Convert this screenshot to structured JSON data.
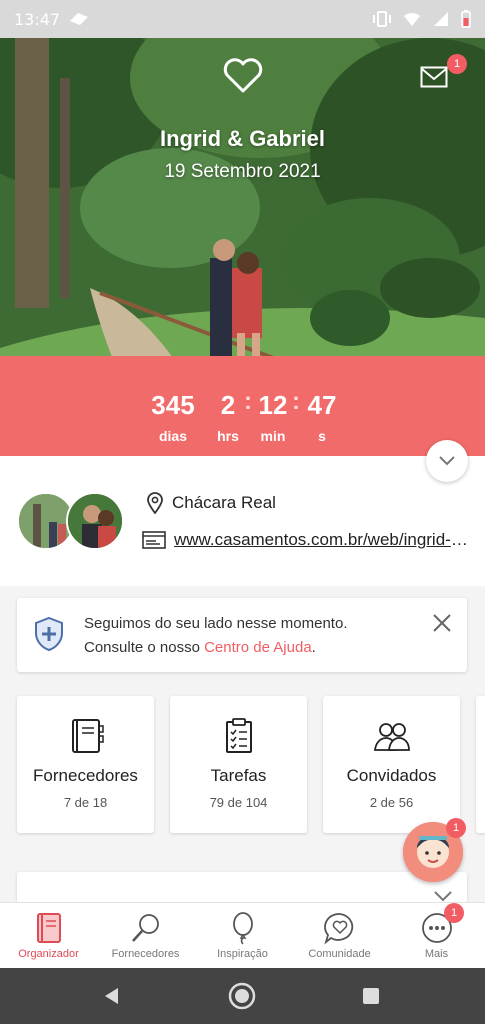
{
  "status_bar": {
    "time": "13:47"
  },
  "hero": {
    "names": "Ingrid & Gabriel",
    "date": "19 Setembro 2021",
    "mail_badge": "1"
  },
  "countdown": {
    "days": "345",
    "days_label": "dias",
    "hours": "2",
    "hours_label": "hrs",
    "minutes": "12",
    "minutes_label": "min",
    "seconds": "47",
    "seconds_label": "s"
  },
  "info": {
    "location": "Chácara Real",
    "website": "www.casamentos.com.br/web/ingrid-e-gabriel"
  },
  "help_card": {
    "line1": "Seguimos do seu lado nesse momento.",
    "line2_prefix": "Consulte o nosso ",
    "line2_link": "Centro de Ajuda",
    "line2_suffix": "."
  },
  "tiles": [
    {
      "title": "Fornecedores",
      "subtitle": "7 de 18"
    },
    {
      "title": "Tarefas",
      "subtitle": "79 de 104"
    },
    {
      "title": "Convidados",
      "subtitle": "2 de 56"
    }
  ],
  "float_badge": "1",
  "nav": {
    "items": [
      {
        "label": "Organizador"
      },
      {
        "label": "Fornecedores"
      },
      {
        "label": "Inspiração"
      },
      {
        "label": "Comunidade"
      },
      {
        "label": "Mais"
      }
    ],
    "more_badge": "1"
  },
  "colors": {
    "accent": "#f15d63",
    "countdown_bg": "#f26b6b"
  }
}
